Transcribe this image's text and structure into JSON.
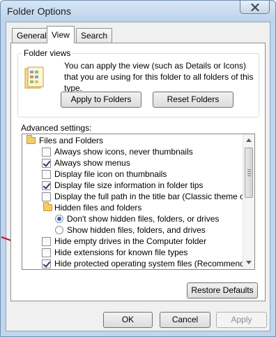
{
  "window": {
    "title": "Folder Options"
  },
  "tabs": [
    {
      "label": "General"
    },
    {
      "label": "View"
    },
    {
      "label": "Search"
    }
  ],
  "folder_views": {
    "group_label": "Folder views",
    "description": "You can apply the view (such as Details or Icons) that you are using for this folder to all folders of this type.",
    "apply_label": "Apply to Folders",
    "reset_label": "Reset Folders"
  },
  "advanced": {
    "label": "Advanced settings:",
    "items": [
      {
        "kind": "folder",
        "label": "Files and Folders"
      },
      {
        "kind": "checkbox",
        "checked": false,
        "label": "Always show icons, never thumbnails"
      },
      {
        "kind": "checkbox",
        "checked": true,
        "label": "Always show menus"
      },
      {
        "kind": "checkbox",
        "checked": false,
        "label": "Display file icon on thumbnails"
      },
      {
        "kind": "checkbox",
        "checked": true,
        "label": "Display file size information in folder tips"
      },
      {
        "kind": "checkbox",
        "checked": false,
        "label": "Display the full path in the title bar (Classic theme only)"
      },
      {
        "kind": "folder",
        "label": "Hidden files and folders"
      },
      {
        "kind": "radio",
        "selected": true,
        "label": "Don't show hidden files, folders, or drives"
      },
      {
        "kind": "radio",
        "selected": false,
        "label": "Show hidden files, folders, and drives"
      },
      {
        "kind": "checkbox",
        "checked": false,
        "label": "Hide empty drives in the Computer folder"
      },
      {
        "kind": "checkbox",
        "checked": false,
        "label": "Hide extensions for known file types"
      },
      {
        "kind": "checkbox",
        "checked": true,
        "label": "Hide protected operating system files (Recommended)"
      }
    ],
    "restore_label": "Restore Defaults"
  },
  "dialog_buttons": {
    "ok_label": "OK",
    "cancel_label": "Cancel",
    "apply_label": "Apply"
  },
  "colors": {
    "annotation_arrow": "#c0161a",
    "title_bar": "#bfd6ee",
    "radio_dot": "#2d5fc7"
  }
}
